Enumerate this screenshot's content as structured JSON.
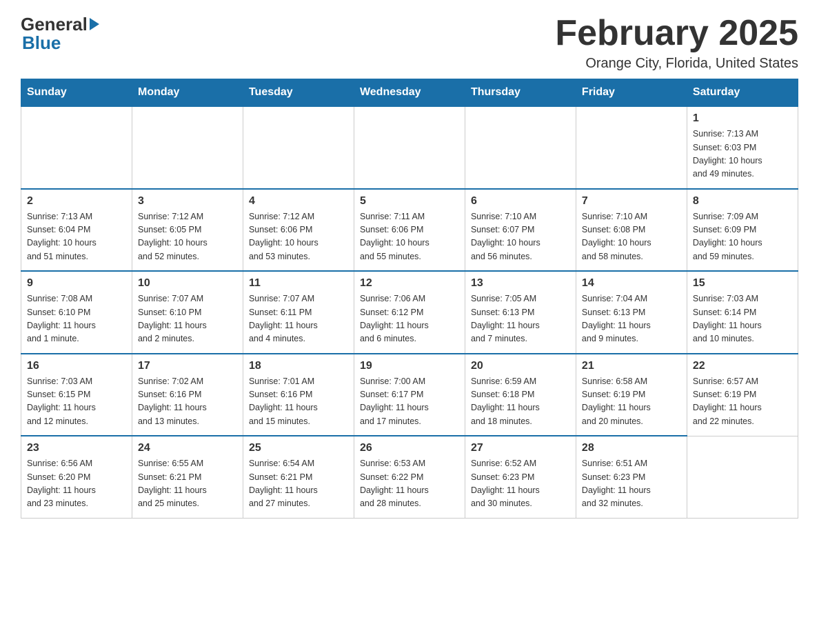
{
  "logo": {
    "general": "General",
    "blue": "Blue"
  },
  "header": {
    "month_year": "February 2025",
    "location": "Orange City, Florida, United States"
  },
  "days_of_week": [
    "Sunday",
    "Monday",
    "Tuesday",
    "Wednesday",
    "Thursday",
    "Friday",
    "Saturday"
  ],
  "weeks": [
    {
      "days": [
        {
          "number": "",
          "info": ""
        },
        {
          "number": "",
          "info": ""
        },
        {
          "number": "",
          "info": ""
        },
        {
          "number": "",
          "info": ""
        },
        {
          "number": "",
          "info": ""
        },
        {
          "number": "",
          "info": ""
        },
        {
          "number": "1",
          "info": "Sunrise: 7:13 AM\nSunset: 6:03 PM\nDaylight: 10 hours\nand 49 minutes."
        }
      ]
    },
    {
      "days": [
        {
          "number": "2",
          "info": "Sunrise: 7:13 AM\nSunset: 6:04 PM\nDaylight: 10 hours\nand 51 minutes."
        },
        {
          "number": "3",
          "info": "Sunrise: 7:12 AM\nSunset: 6:05 PM\nDaylight: 10 hours\nand 52 minutes."
        },
        {
          "number": "4",
          "info": "Sunrise: 7:12 AM\nSunset: 6:06 PM\nDaylight: 10 hours\nand 53 minutes."
        },
        {
          "number": "5",
          "info": "Sunrise: 7:11 AM\nSunset: 6:06 PM\nDaylight: 10 hours\nand 55 minutes."
        },
        {
          "number": "6",
          "info": "Sunrise: 7:10 AM\nSunset: 6:07 PM\nDaylight: 10 hours\nand 56 minutes."
        },
        {
          "number": "7",
          "info": "Sunrise: 7:10 AM\nSunset: 6:08 PM\nDaylight: 10 hours\nand 58 minutes."
        },
        {
          "number": "8",
          "info": "Sunrise: 7:09 AM\nSunset: 6:09 PM\nDaylight: 10 hours\nand 59 minutes."
        }
      ]
    },
    {
      "days": [
        {
          "number": "9",
          "info": "Sunrise: 7:08 AM\nSunset: 6:10 PM\nDaylight: 11 hours\nand 1 minute."
        },
        {
          "number": "10",
          "info": "Sunrise: 7:07 AM\nSunset: 6:10 PM\nDaylight: 11 hours\nand 2 minutes."
        },
        {
          "number": "11",
          "info": "Sunrise: 7:07 AM\nSunset: 6:11 PM\nDaylight: 11 hours\nand 4 minutes."
        },
        {
          "number": "12",
          "info": "Sunrise: 7:06 AM\nSunset: 6:12 PM\nDaylight: 11 hours\nand 6 minutes."
        },
        {
          "number": "13",
          "info": "Sunrise: 7:05 AM\nSunset: 6:13 PM\nDaylight: 11 hours\nand 7 minutes."
        },
        {
          "number": "14",
          "info": "Sunrise: 7:04 AM\nSunset: 6:13 PM\nDaylight: 11 hours\nand 9 minutes."
        },
        {
          "number": "15",
          "info": "Sunrise: 7:03 AM\nSunset: 6:14 PM\nDaylight: 11 hours\nand 10 minutes."
        }
      ]
    },
    {
      "days": [
        {
          "number": "16",
          "info": "Sunrise: 7:03 AM\nSunset: 6:15 PM\nDaylight: 11 hours\nand 12 minutes."
        },
        {
          "number": "17",
          "info": "Sunrise: 7:02 AM\nSunset: 6:16 PM\nDaylight: 11 hours\nand 13 minutes."
        },
        {
          "number": "18",
          "info": "Sunrise: 7:01 AM\nSunset: 6:16 PM\nDaylight: 11 hours\nand 15 minutes."
        },
        {
          "number": "19",
          "info": "Sunrise: 7:00 AM\nSunset: 6:17 PM\nDaylight: 11 hours\nand 17 minutes."
        },
        {
          "number": "20",
          "info": "Sunrise: 6:59 AM\nSunset: 6:18 PM\nDaylight: 11 hours\nand 18 minutes."
        },
        {
          "number": "21",
          "info": "Sunrise: 6:58 AM\nSunset: 6:19 PM\nDaylight: 11 hours\nand 20 minutes."
        },
        {
          "number": "22",
          "info": "Sunrise: 6:57 AM\nSunset: 6:19 PM\nDaylight: 11 hours\nand 22 minutes."
        }
      ]
    },
    {
      "days": [
        {
          "number": "23",
          "info": "Sunrise: 6:56 AM\nSunset: 6:20 PM\nDaylight: 11 hours\nand 23 minutes."
        },
        {
          "number": "24",
          "info": "Sunrise: 6:55 AM\nSunset: 6:21 PM\nDaylight: 11 hours\nand 25 minutes."
        },
        {
          "number": "25",
          "info": "Sunrise: 6:54 AM\nSunset: 6:21 PM\nDaylight: 11 hours\nand 27 minutes."
        },
        {
          "number": "26",
          "info": "Sunrise: 6:53 AM\nSunset: 6:22 PM\nDaylight: 11 hours\nand 28 minutes."
        },
        {
          "number": "27",
          "info": "Sunrise: 6:52 AM\nSunset: 6:23 PM\nDaylight: 11 hours\nand 30 minutes."
        },
        {
          "number": "28",
          "info": "Sunrise: 6:51 AM\nSunset: 6:23 PM\nDaylight: 11 hours\nand 32 minutes."
        },
        {
          "number": "",
          "info": ""
        }
      ]
    }
  ]
}
